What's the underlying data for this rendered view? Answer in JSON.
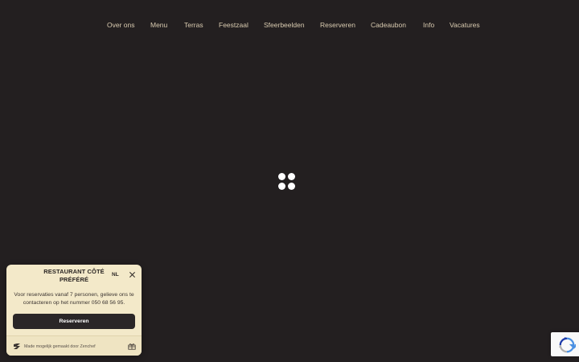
{
  "nav": {
    "items": [
      {
        "label": "Over ons"
      },
      {
        "label": "Menu"
      },
      {
        "label": "Terras"
      },
      {
        "label": "Feestzaal"
      },
      {
        "label": "Sfeerbeelden"
      },
      {
        "label": "Reserveren"
      },
      {
        "label": "Cadeaubon"
      },
      {
        "label": "Info"
      },
      {
        "label": "Vacatures"
      }
    ]
  },
  "loader": {
    "icon": "loading-dots-icon"
  },
  "widget": {
    "title": "RESTAURANT CÔTÉ PRÉFÉRÉ",
    "language": "NL",
    "description": "Voor reservaties vanaf 7 personen, gelieve ons te contacteren op het nummer 050 68 56 95.",
    "button_label": "Reserveren",
    "footer_text": "Made mogelijk gemaakt door Zenchef",
    "icons": {
      "close": "close-icon",
      "logo": "zenchef-logo-icon",
      "gift": "gift-icon"
    }
  },
  "recaptcha": {
    "icon": "recaptcha-icon"
  },
  "colors": {
    "background": "#231f20",
    "nav_text": "#d9cbb0",
    "widget_bg": "#f3e9c9",
    "button_bg": "#2a2627",
    "button_text": "#ffffff"
  }
}
